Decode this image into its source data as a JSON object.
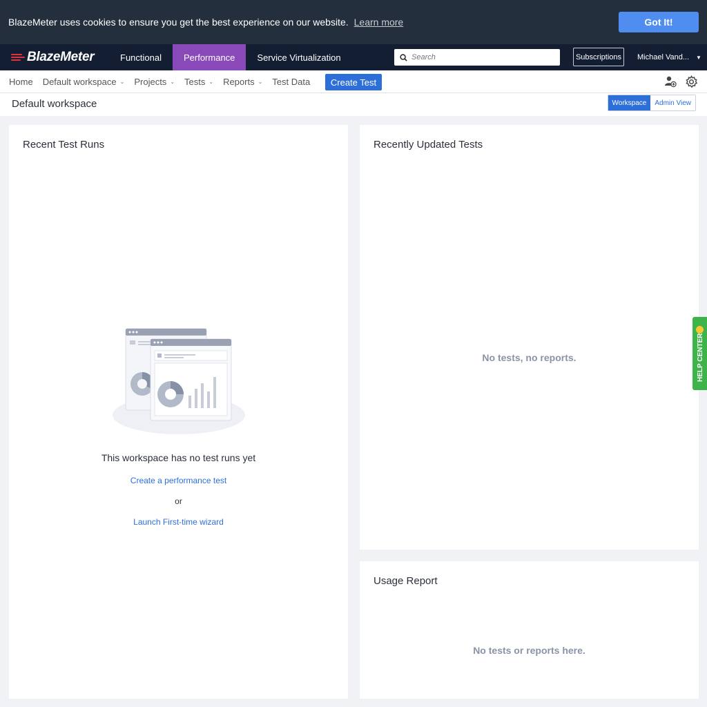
{
  "cookie": {
    "message": "BlazeMeter uses cookies to ensure you get the best experience on our website.",
    "learn_more": "Learn more",
    "accept": "Got It!"
  },
  "topnav": {
    "logo": "BlazeMeter",
    "tabs": [
      {
        "label": "Functional",
        "active": false
      },
      {
        "label": "Performance",
        "active": true
      },
      {
        "label": "Service Virtualization",
        "active": false
      }
    ],
    "search_placeholder": "Search",
    "subscriptions": "Subscriptions",
    "user": "Michael Vand..."
  },
  "subnav": {
    "home": "Home",
    "workspace": "Default workspace",
    "projects": "Projects",
    "tests": "Tests",
    "reports": "Reports",
    "test_data": "Test Data",
    "create_test": "Create Test"
  },
  "workspace": {
    "title": "Default workspace",
    "view_workspace": "Workspace",
    "view_admin": "Admin View"
  },
  "recent_runs": {
    "title": "Recent Test Runs",
    "empty_title": "This workspace has no test runs yet",
    "create_link": "Create a performance test",
    "or": "or",
    "wizard_link": "Launch First-time wizard"
  },
  "recent_tests": {
    "title": "Recently Updated Tests",
    "empty": "No tests, no reports."
  },
  "usage": {
    "title": "Usage Report",
    "empty": "No tests or reports here."
  },
  "help": {
    "label": "HELP CENTER"
  },
  "colors": {
    "accent": "#2c6fd8",
    "performance_tab": "#8a49b8",
    "nav_bg": "#141e33",
    "cookie_bg": "#232f3c",
    "help_green": "#3db34a"
  }
}
